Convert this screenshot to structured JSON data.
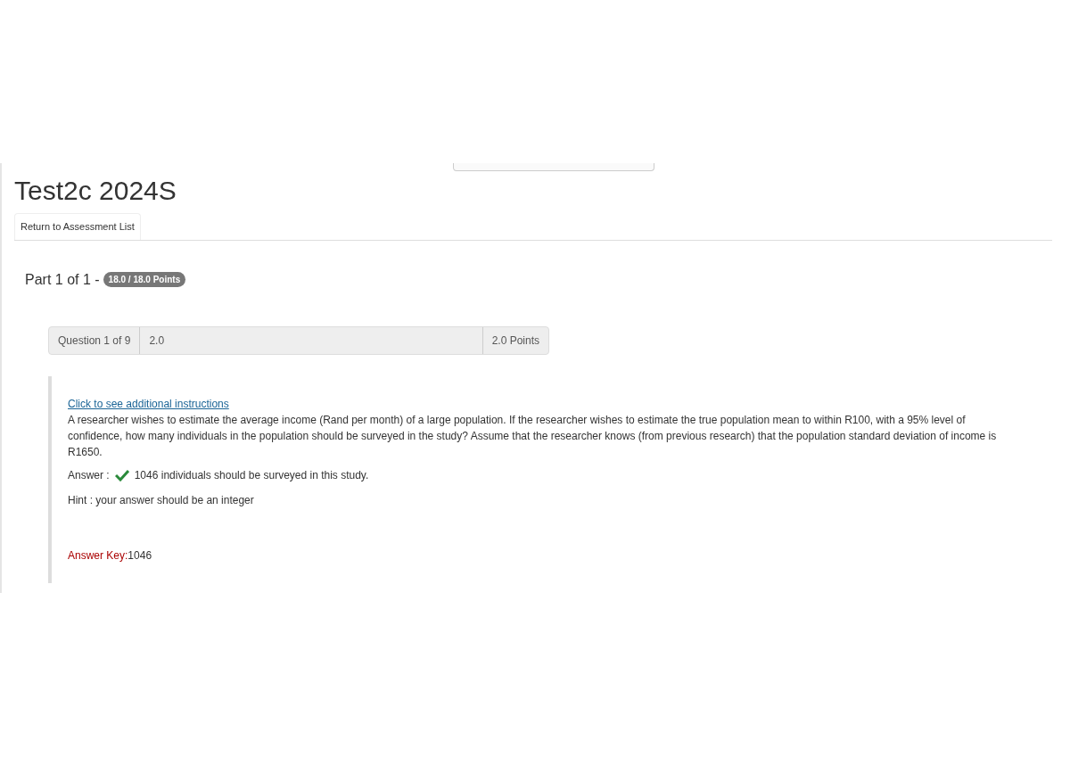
{
  "page": {
    "title": "Test2c 2024S"
  },
  "return_link": {
    "label": "Return to Assessment List"
  },
  "part": {
    "label": "Part 1 of 1 -",
    "score_badge": "18.0 / 18.0 Points"
  },
  "question": {
    "number": "Question 1 of 9",
    "score": "2.0",
    "points": "2.0 Points",
    "instructions_link": "Click to see additional instructions",
    "text": "A researcher wishes to estimate the average income (Rand per month) of a large population. If the researcher wishes to estimate the true population mean to within R100, with a 95% level of confidence, how many individuals in the population should be surveyed in the study? Assume that the researcher knows (from previous research) that the population standard deviation of income is R1650.",
    "answer_label": "Answer :",
    "answer_correct": true,
    "answer": "1046 individuals should be surveyed in this study.",
    "hint": "Hint : your answer should be an integer",
    "answer_key_label": "Answer Key:",
    "answer_key": "1046"
  }
}
